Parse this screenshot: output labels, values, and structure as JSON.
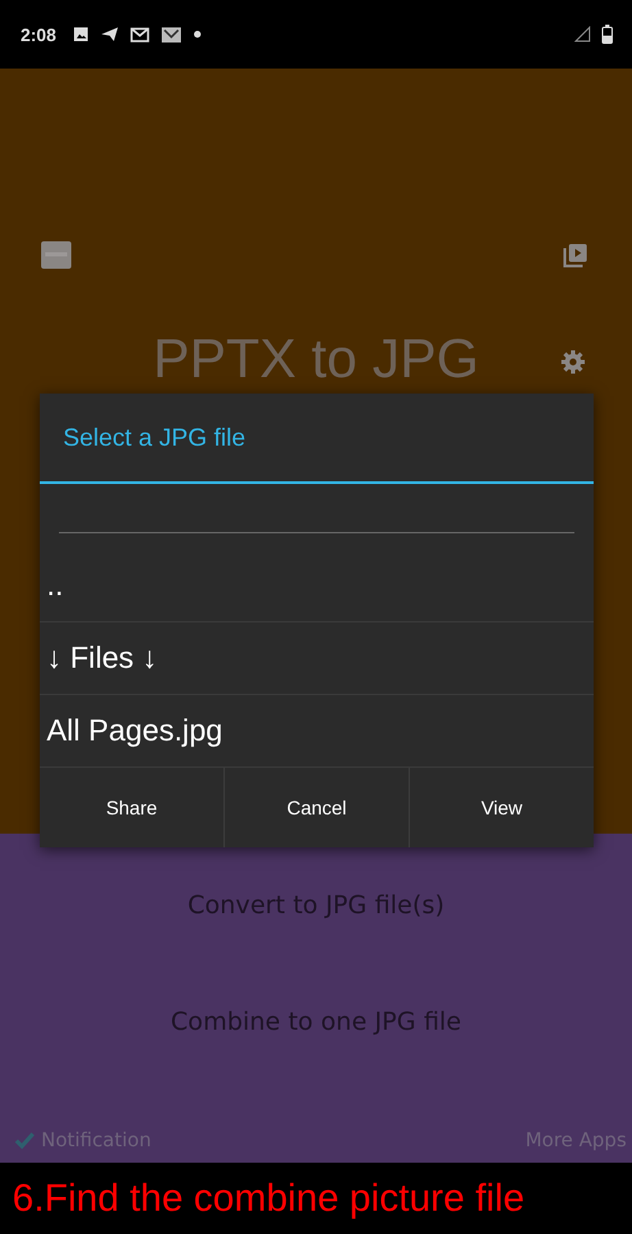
{
  "status_bar": {
    "time": "2:08"
  },
  "app": {
    "title": "PPTX to JPG",
    "actions": [
      "Convert to JPG file(s)",
      "Combine to one JPG file"
    ],
    "notification": {
      "label": "Notification",
      "checked": true
    },
    "more_apps": "More Apps"
  },
  "dialog": {
    "title": "Select a JPG file",
    "items": [
      {
        "label": ".."
      },
      {
        "label": "↓ Files ↓"
      },
      {
        "label": "All Pages.jpg"
      }
    ],
    "buttons": [
      "Share",
      "Cancel",
      "View"
    ]
  },
  "caption": "6.Find the combine picture file"
}
